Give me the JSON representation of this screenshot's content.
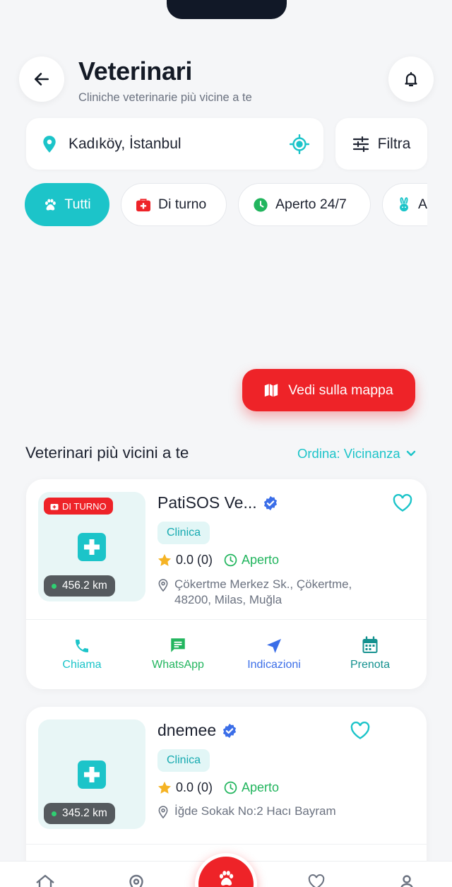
{
  "header": {
    "title": "Veterinari",
    "subtitle": "Cliniche veterinarie più vicine a te"
  },
  "location": {
    "value": "Kadıköy, İstanbul"
  },
  "filter": {
    "label": "Filtra"
  },
  "chips": [
    {
      "label": "Tutti",
      "icon": "paw-icon",
      "active": true
    },
    {
      "label": "Di turno",
      "icon": "first-aid-icon",
      "active": false
    },
    {
      "label": "Aperto 24/7",
      "icon": "clock-icon",
      "active": false
    },
    {
      "label": "A",
      "icon": "rabbit-icon",
      "active": false
    }
  ],
  "map_button": {
    "label": "Vedi sulla mappa"
  },
  "list": {
    "title": "Veterinari più vicini a te",
    "sort_label": "Ordina: Vicinanza"
  },
  "clinics": [
    {
      "name": "PatiSOS Ve...",
      "badge": "DI TURNO",
      "distance": "456.2 km",
      "type": "Clinica",
      "rating": "0.0 (0)",
      "status": "Aperto",
      "address_line1": "Çökertme Merkez Sk., Çökertme,",
      "address_line2": "48200, Milas, Muğla"
    },
    {
      "name": "dnemee",
      "distance": "345.2 km",
      "type": "Clinica",
      "rating": "0.0 (0)",
      "status": "Aperto",
      "address_line1": "İğde Sokak No:2 Hacı Bayram"
    }
  ],
  "actions": {
    "call": "Chiama",
    "whatsapp": "WhatsApp",
    "directions": "Indicazioni",
    "book": "Prenota"
  },
  "colors": {
    "accent": "#1cc4c9",
    "danger": "#ee2328",
    "whatsapp": "#22b55e",
    "directions": "#3b6ee8",
    "book": "#14918f"
  },
  "nav": [
    "home-icon",
    "map-pin-icon",
    "paw-icon",
    "heart-icon",
    "profile-icon"
  ]
}
